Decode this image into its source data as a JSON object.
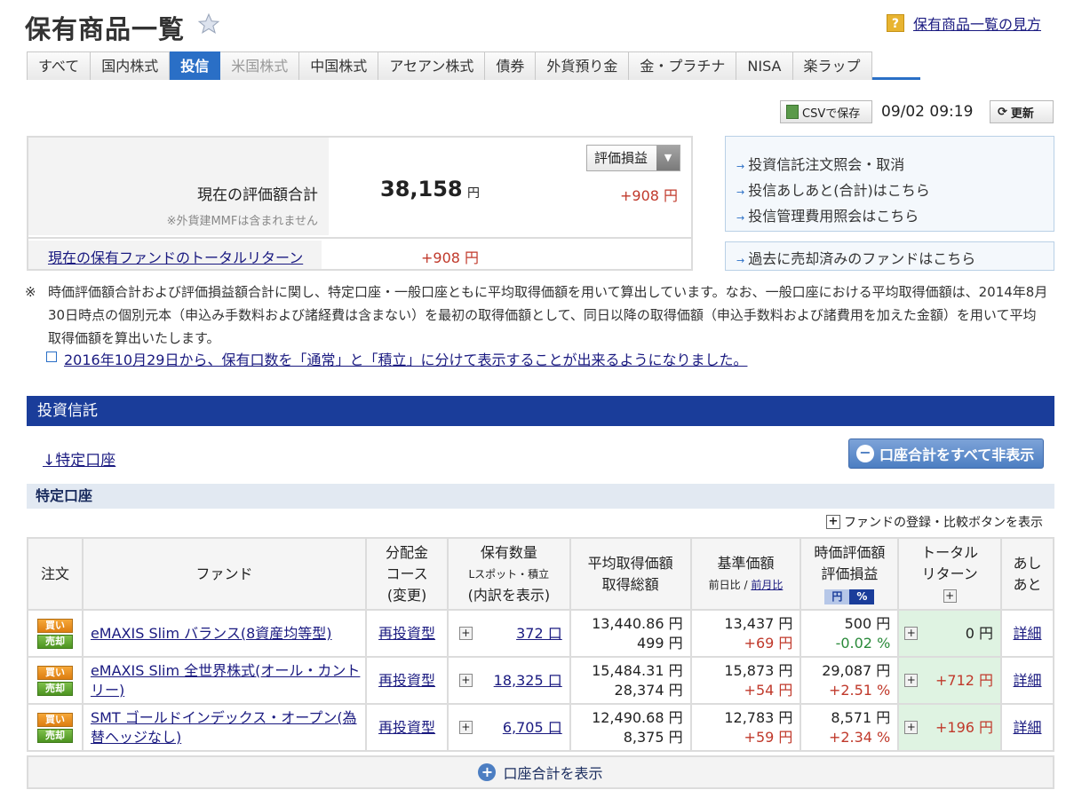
{
  "header": {
    "title": "保有商品一覧",
    "help_icon": "?",
    "help_link": "保有商品一覧の見方"
  },
  "tabs": [
    {
      "label": "すべて",
      "state": "normal"
    },
    {
      "label": "国内株式",
      "state": "normal"
    },
    {
      "label": "投信",
      "state": "active"
    },
    {
      "label": "米国株式",
      "state": "disabled"
    },
    {
      "label": "中国株式",
      "state": "normal"
    },
    {
      "label": "アセアン株式",
      "state": "normal"
    },
    {
      "label": "債券",
      "state": "normal"
    },
    {
      "label": "外貨預り金",
      "state": "normal"
    },
    {
      "label": "金・プラチナ",
      "state": "normal"
    },
    {
      "label": "NISA",
      "state": "normal"
    },
    {
      "label": "楽ラップ",
      "state": "normal"
    }
  ],
  "toolbar": {
    "csv_label": "CSVで保存",
    "timestamp": "09/02 09:19",
    "refresh_label": "更新"
  },
  "summary": {
    "label": "現在の評価額合計",
    "note": "※外貨建MMFは含まれません",
    "value": "38,158",
    "unit": "円",
    "select_value": "評価損益",
    "gain": "+908 円",
    "total_return_label": "現在の保有ファンドのトータルリターン",
    "total_return_value": "+908 円"
  },
  "links": [
    "投資信託注文照会・取消",
    "投信あしあと(合計)はこちら",
    "投信管理費用照会はこちら"
  ],
  "past_link": "過去に売却済みのファンドはこちら",
  "notes": {
    "mark": "※",
    "text": "時価評価額合計および評価損益額合計に関し、特定口座・一般口座ともに平均取得価額を用いて算出しています。なお、一般口座における平均取得価額は、2014年8月30日時点の個別元本（申込み手数料および諸経費は含まない）を最初の取得価額として、同日以降の取得価額（申込手数料および諸費用を加えた金額）を用いて平均取得価額を算出いたします。",
    "link": "2016年10月29日から、保有口数を「通常」と「積立」に分けて表示することが出来るようになりました。"
  },
  "section": {
    "title": "投資信託",
    "account_link": "↓特定口座",
    "hide_all_label": "口座合計をすべて非表示",
    "sub_title": "特定口座",
    "compare_link": "ファンドの登録・比較ボタンを表示"
  },
  "table": {
    "headers": {
      "order": "注文",
      "fund": "ファンド",
      "dist1": "分配金",
      "dist2": "コース",
      "dist3": "(変更)",
      "qty1": "保有数量",
      "qty2": "Lスポット・積立",
      "qty3": "(内訳を表示)",
      "avg1": "平均取得価額",
      "avg2": "取得総額",
      "base1": "基準価額",
      "base2a": "前日比 / ",
      "base2b": "前月比",
      "eval1": "時価評価額",
      "eval2": "評価損益",
      "yen_toggle": "円",
      "pct_toggle": "%",
      "ret1": "トータル",
      "ret2": "リターン",
      "ashi1": "あし",
      "ashi2": "あと"
    },
    "buy_label": "買い",
    "sell_label": "売却",
    "rows": [
      {
        "fund": "eMAXIS Slim バランス(8資産均等型)",
        "course": "再投資型",
        "qty": "372 口",
        "avg": "13,440.86 円",
        "cost": "499 円",
        "base": "13,437 円",
        "base_change": "+69 円",
        "eval": "500 円",
        "gain": "-0.02 %",
        "gain_color": "green",
        "ret": "0 円",
        "ret_color": "black",
        "detail": "詳細"
      },
      {
        "fund": "eMAXIS Slim 全世界株式(オール・カントリー)",
        "course": "再投資型",
        "qty": "18,325 口",
        "avg": "15,484.31 円",
        "cost": "28,374 円",
        "base": "15,873 円",
        "base_change": "+54 円",
        "eval": "29,087 円",
        "gain": "+2.51 %",
        "gain_color": "red",
        "ret": "+712 円",
        "ret_color": "red",
        "detail": "詳細"
      },
      {
        "fund": "SMT ゴールドインデックス・オープン(為替ヘッジなし)",
        "course": "再投資型",
        "qty": "6,705 口",
        "avg": "12,490.68 円",
        "cost": "8,375 円",
        "base": "12,783 円",
        "base_change": "+59 円",
        "eval": "8,571 円",
        "gain": "+2.34 %",
        "gain_color": "red",
        "ret": "+196 円",
        "ret_color": "red",
        "detail": "詳細"
      }
    ],
    "show_total_label": "口座合計を表示"
  }
}
